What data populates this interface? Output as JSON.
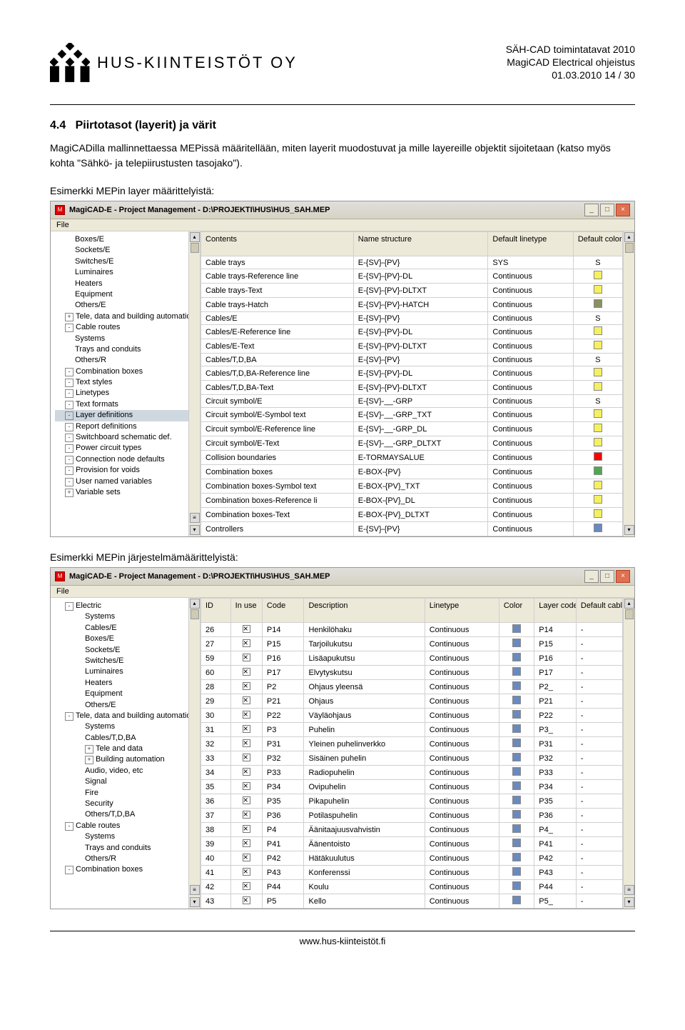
{
  "header": {
    "company": "HUS-KIINTEISTÖT OY",
    "lines": [
      "SÄH-CAD toimintatavat 2010",
      "MagiCAD Electrical ohjeistus",
      "01.03.2010     14 / 30"
    ]
  },
  "section": {
    "number": "4.4",
    "title": "Piirtotasot (layerit) ja värit",
    "body": "MagiCADilla mallinnettaessa MEPissä määritellään, miten layerit muodostuvat ja mille layereille objektit sijoitetaan (katso myös kohta \"Sähkö- ja telepiirustusten tasojako\").",
    "example1": "Esimerkki MEPin layer määrittelyistä:",
    "example2": "Esimerkki MEPin järjestelmämäärittelyistä:"
  },
  "win1": {
    "title": "MagiCAD-E - Project Management - D:\\PROJEKTI\\HUS\\HUS_SAH.MEP",
    "menu": "File",
    "tree": [
      {
        "label": "Boxes/E",
        "cls": ""
      },
      {
        "label": "Sockets/E",
        "cls": ""
      },
      {
        "label": "Switches/E",
        "cls": ""
      },
      {
        "label": "Luminaires",
        "cls": ""
      },
      {
        "label": "Heaters",
        "cls": ""
      },
      {
        "label": "Equipment",
        "cls": ""
      },
      {
        "label": "Others/E",
        "cls": ""
      },
      {
        "label": "Tele, data and building automation",
        "cls": "exp",
        "sym": "+"
      },
      {
        "label": "Cable routes",
        "cls": "exp",
        "sym": "-"
      },
      {
        "label": "Systems",
        "cls": ""
      },
      {
        "label": "Trays and conduits",
        "cls": ""
      },
      {
        "label": "Others/R",
        "cls": ""
      },
      {
        "label": "Combination boxes",
        "cls": "exp",
        "sym": "-"
      },
      {
        "label": "Text styles",
        "cls": "exp",
        "sym": "-"
      },
      {
        "label": "Linetypes",
        "cls": "exp",
        "sym": "-"
      },
      {
        "label": "Text formats",
        "cls": "exp",
        "sym": "-"
      },
      {
        "label": "Layer definitions",
        "cls": "exp sel",
        "sym": "-"
      },
      {
        "label": "Report definitions",
        "cls": "exp",
        "sym": "-"
      },
      {
        "label": "Switchboard schematic def.",
        "cls": "exp",
        "sym": "-"
      },
      {
        "label": "Power circuit types",
        "cls": "exp",
        "sym": "-"
      },
      {
        "label": "Connection node defaults",
        "cls": "exp",
        "sym": "-"
      },
      {
        "label": "Provision for voids",
        "cls": "exp",
        "sym": "-"
      },
      {
        "label": "User named variables",
        "cls": "exp",
        "sym": "-"
      },
      {
        "label": "Variable sets",
        "cls": "exp",
        "sym": "+"
      }
    ],
    "headers": [
      "Contents",
      "Name structure",
      "Default linetype",
      "Default color"
    ],
    "rows": [
      {
        "c": "Cable trays",
        "n": "E-{SV}-{PV}",
        "lt": "SYS",
        "col": null,
        "colText": "S"
      },
      {
        "c": "Cable trays-Reference line",
        "n": "E-{SV}-{PV}-DL",
        "lt": "Continuous",
        "col": "#f5f060"
      },
      {
        "c": "Cable trays-Text",
        "n": "E-{SV}-{PV}-DLTXT",
        "lt": "Continuous",
        "col": "#f5f060"
      },
      {
        "c": "Cable trays-Hatch",
        "n": "E-{SV}-{PV}-HATCH",
        "lt": "Continuous",
        "col": "#8a9060"
      },
      {
        "c": "Cables/E",
        "n": "E-{SV}-{PV}",
        "lt": "Continuous",
        "col": null,
        "colText": "S"
      },
      {
        "c": "Cables/E-Reference line",
        "n": "E-{SV}-{PV}-DL",
        "lt": "Continuous",
        "col": "#f5f060"
      },
      {
        "c": "Cables/E-Text",
        "n": "E-{SV}-{PV}-DLTXT",
        "lt": "Continuous",
        "col": "#f5f060"
      },
      {
        "c": "Cables/T,D,BA",
        "n": "E-{SV}-{PV}",
        "lt": "Continuous",
        "col": null,
        "colText": "S"
      },
      {
        "c": "Cables/T,D,BA-Reference line",
        "n": "E-{SV}-{PV}-DL",
        "lt": "Continuous",
        "col": "#f5f060"
      },
      {
        "c": "Cables/T,D,BA-Text",
        "n": "E-{SV}-{PV}-DLTXT",
        "lt": "Continuous",
        "col": "#f5f060"
      },
      {
        "c": "Circuit symbol/E",
        "n": "E-{SV}-__-GRP",
        "lt": "Continuous",
        "col": null,
        "colText": "S"
      },
      {
        "c": "Circuit symbol/E-Symbol text",
        "n": "E-{SV}-__-GRP_TXT",
        "lt": "Continuous",
        "col": "#f5f060"
      },
      {
        "c": "Circuit symbol/E-Reference line",
        "n": "E-{SV}-__-GRP_DL",
        "lt": "Continuous",
        "col": "#f5f060"
      },
      {
        "c": "Circuit symbol/E-Text",
        "n": "E-{SV}-__-GRP_DLTXT",
        "lt": "Continuous",
        "col": "#f5f060"
      },
      {
        "c": "Collision boundaries",
        "n": "E-TORMAYSALUE",
        "lt": "Continuous",
        "col": "#ff0000"
      },
      {
        "c": "Combination boxes",
        "n": "E-BOX-{PV}",
        "lt": "Continuous",
        "col": "#4fa84f"
      },
      {
        "c": "Combination boxes-Symbol text",
        "n": "E-BOX-{PV}_TXT",
        "lt": "Continuous",
        "col": "#f5f060"
      },
      {
        "c": "Combination boxes-Reference li",
        "n": "E-BOX-{PV}_DL",
        "lt": "Continuous",
        "col": "#f5f060"
      },
      {
        "c": "Combination boxes-Text",
        "n": "E-BOX-{PV}_DLTXT",
        "lt": "Continuous",
        "col": "#f5f060"
      },
      {
        "c": "Controllers",
        "n": "E-{SV}-{PV}",
        "lt": "Continuous",
        "col": "#6a8abf"
      }
    ]
  },
  "win2": {
    "title": "MagiCAD-E - Project Management - D:\\PROJEKTI\\HUS\\HUS_SAH.MEP",
    "menu": "File",
    "tree": [
      {
        "label": "Electric",
        "cls": "exp",
        "sym": "-"
      },
      {
        "label": "Systems",
        "cls": "i2"
      },
      {
        "label": "Cables/E",
        "cls": "i2"
      },
      {
        "label": "Boxes/E",
        "cls": "i2"
      },
      {
        "label": "Sockets/E",
        "cls": "i2"
      },
      {
        "label": "Switches/E",
        "cls": "i2"
      },
      {
        "label": "Luminaires",
        "cls": "i2"
      },
      {
        "label": "Heaters",
        "cls": "i2"
      },
      {
        "label": "Equipment",
        "cls": "i2"
      },
      {
        "label": "Others/E",
        "cls": "i2"
      },
      {
        "label": "Tele, data and building automation",
        "cls": "exp",
        "sym": "-"
      },
      {
        "label": "Systems",
        "cls": "i2"
      },
      {
        "label": "Cables/T,D,BA",
        "cls": "i2"
      },
      {
        "label": "Tele and data",
        "cls": "i2 exp",
        "sym": "+"
      },
      {
        "label": "Building automation",
        "cls": "i2 exp",
        "sym": "+"
      },
      {
        "label": "Audio, video, etc",
        "cls": "i2"
      },
      {
        "label": "Signal",
        "cls": "i2"
      },
      {
        "label": "Fire",
        "cls": "i2"
      },
      {
        "label": "Security",
        "cls": "i2"
      },
      {
        "label": "Others/T,D,BA",
        "cls": "i2"
      },
      {
        "label": "Cable routes",
        "cls": "exp",
        "sym": "-"
      },
      {
        "label": "Systems",
        "cls": "i2"
      },
      {
        "label": "Trays and conduits",
        "cls": "i2"
      },
      {
        "label": "Others/R",
        "cls": "i2"
      },
      {
        "label": "Combination boxes",
        "cls": "exp",
        "sym": "-"
      }
    ],
    "headers": [
      "ID",
      "In use",
      "Code",
      "Description",
      "Linetype",
      "Color",
      "Layer code",
      "Default cable"
    ],
    "rows": [
      {
        "id": "26",
        "code": "P14",
        "desc": "Henkilöhaku",
        "lt": "Continuous",
        "col": "#6a8abf",
        "lc": "P14",
        "dc": "-"
      },
      {
        "id": "27",
        "code": "P15",
        "desc": "Tarjoilukutsu",
        "lt": "Continuous",
        "col": "#6a8abf",
        "lc": "P15",
        "dc": "-"
      },
      {
        "id": "59",
        "code": "P16",
        "desc": "Lisäapukutsu",
        "lt": "Continuous",
        "col": "#6a8abf",
        "lc": "P16",
        "dc": "-"
      },
      {
        "id": "60",
        "code": "P17",
        "desc": "Elvytyskutsu",
        "lt": "Continuous",
        "col": "#6a8abf",
        "lc": "P17",
        "dc": "-"
      },
      {
        "id": "28",
        "code": "P2",
        "desc": "Ohjaus yleensä",
        "lt": "Continuous",
        "col": "#6a8abf",
        "lc": "P2_",
        "dc": "-"
      },
      {
        "id": "29",
        "code": "P21",
        "desc": "Ohjaus",
        "lt": "Continuous",
        "col": "#6a8abf",
        "lc": "P21",
        "dc": "-"
      },
      {
        "id": "30",
        "code": "P22",
        "desc": "Väyläohjaus",
        "lt": "Continuous",
        "col": "#6a8abf",
        "lc": "P22",
        "dc": "-"
      },
      {
        "id": "31",
        "code": "P3",
        "desc": "Puhelin",
        "lt": "Continuous",
        "col": "#6a8abf",
        "lc": "P3_",
        "dc": "-"
      },
      {
        "id": "32",
        "code": "P31",
        "desc": "Yleinen puhelinverkko",
        "lt": "Continuous",
        "col": "#6a8abf",
        "lc": "P31",
        "dc": "-"
      },
      {
        "id": "33",
        "code": "P32",
        "desc": "Sisäinen puhelin",
        "lt": "Continuous",
        "col": "#6a8abf",
        "lc": "P32",
        "dc": "-"
      },
      {
        "id": "34",
        "code": "P33",
        "desc": "Radiopuhelin",
        "lt": "Continuous",
        "col": "#6a8abf",
        "lc": "P33",
        "dc": "-"
      },
      {
        "id": "35",
        "code": "P34",
        "desc": "Ovipuhelin",
        "lt": "Continuous",
        "col": "#6a8abf",
        "lc": "P34",
        "dc": "-"
      },
      {
        "id": "36",
        "code": "P35",
        "desc": "Pikapuhelin",
        "lt": "Continuous",
        "col": "#6a8abf",
        "lc": "P35",
        "dc": "-"
      },
      {
        "id": "37",
        "code": "P36",
        "desc": "Potilaspuhelin",
        "lt": "Continuous",
        "col": "#6a8abf",
        "lc": "P36",
        "dc": "-"
      },
      {
        "id": "38",
        "code": "P4",
        "desc": "Äänitaajuusvahvistin",
        "lt": "Continuous",
        "col": "#6a8abf",
        "lc": "P4_",
        "dc": "-"
      },
      {
        "id": "39",
        "code": "P41",
        "desc": "Äänentoisto",
        "lt": "Continuous",
        "col": "#6a8abf",
        "lc": "P41",
        "dc": "-"
      },
      {
        "id": "40",
        "code": "P42",
        "desc": "Hätäkuulutus",
        "lt": "Continuous",
        "col": "#6a8abf",
        "lc": "P42",
        "dc": "-"
      },
      {
        "id": "41",
        "code": "P43",
        "desc": "Konferenssi",
        "lt": "Continuous",
        "col": "#6a8abf",
        "lc": "P43",
        "dc": "-"
      },
      {
        "id": "42",
        "code": "P44",
        "desc": "Koulu",
        "lt": "Continuous",
        "col": "#6a8abf",
        "lc": "P44",
        "dc": "-"
      },
      {
        "id": "43",
        "code": "P5",
        "desc": "Kello",
        "lt": "Continuous",
        "col": "#6a8abf",
        "lc": "P5_",
        "dc": "-"
      }
    ]
  },
  "footer": "www.hus-kiinteistöt.fi"
}
